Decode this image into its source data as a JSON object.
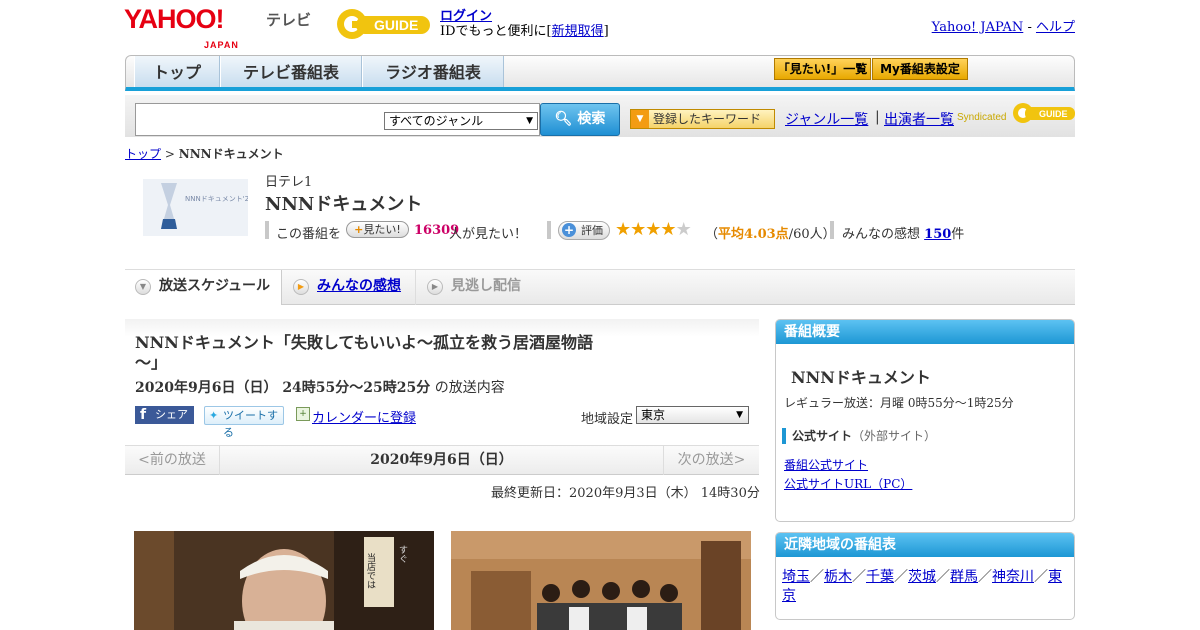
{
  "header": {
    "yahoo_logo": "YAHOO!",
    "yahoo_sub": "JAPAN",
    "tv_word": "テレビ",
    "gguide_logo": "GUIDE",
    "login_link": "ログイン",
    "login_note_prefix": "IDでもっと便利に[",
    "signup_link": "新規取得",
    "login_note_suffix": "]",
    "yahoo_japan_link": "Yahoo! JAPAN",
    "links_sep": "-",
    "help_link": "ヘルプ"
  },
  "nav": {
    "tabs": [
      "トップ",
      "テレビ番組表",
      "ラジオ番組表"
    ],
    "mitai_list": "「見たい!」一覧",
    "my_listing": "My番組表設定"
  },
  "search": {
    "input_value": "",
    "genre_selected": "すべてのジャンル",
    "search_button": "検索",
    "keyword_button": "登録したキーワード",
    "genre_list_link": "ジャンル一覧",
    "separator": "|",
    "cast_list_link": "出演者一覧",
    "syndicated": "Syndicated",
    "synd_logo": "GUIDE"
  },
  "breadcrumb": {
    "top": "トップ",
    "sep": ">",
    "current": "NNNドキュメント"
  },
  "program": {
    "thumb_text": "NNNドキュメント'20",
    "channel": "日テレ1",
    "title": "NNNドキュメント",
    "want_prefix": "この番組を",
    "want_button": "見たい!",
    "want_count": "16309",
    "want_suffix": "人が見たい！",
    "rate_button": "評価",
    "rating_value": 4.03,
    "avg_prefix": "（",
    "avg_label": "平均4.03点",
    "avg_suffix": "/60人）",
    "reviews_label": "みんなの感想",
    "reviews_count": "150",
    "reviews_unit": "件"
  },
  "tabs": {
    "schedule": "放送スケジュール",
    "reviews": "みんなの感想",
    "missed": "見逃し配信"
  },
  "episode": {
    "title": "NNNドキュメント「失敗してもいいよ～孤立を救う居酒屋物語～」",
    "date_bold": "2020年9月6日（日） 24時55分～25時25分",
    "date_suffix": "の放送内容",
    "share_facebook": "シェア",
    "share_twitter": "ツイートする",
    "calendar_link": "カレンダーに登録",
    "region_label": "地域設定",
    "region_selected": "東京",
    "prev_label": "<前の放送",
    "pager_date": "2020年9月6日（日）",
    "next_label": "次の放送>",
    "updated": "最終更新日：2020年9月3日（木） 14時30分",
    "photo1_sign_1": "当店では",
    "photo1_sign_2": "すぐ"
  },
  "overview": {
    "heading": "番組概要",
    "name": "NNNドキュメント",
    "regular": "レギュラー放送：月曜 0時55分～1時25分",
    "official_heading": "公式サイト",
    "official_note": "（外部サイト）",
    "link1": "番組公式サイト",
    "link2": "公式サイトURL（PC）"
  },
  "neighbors": {
    "heading": "近隣地域の番組表",
    "prefectures": [
      "埼玉",
      "栃木",
      "千葉",
      "茨城",
      "群馬",
      "神奈川",
      "東京"
    ],
    "separator": "／"
  },
  "colors": {
    "accent_blue": "#1d97d4",
    "want_count": "#cc0066",
    "rating_orange": "#e68a00",
    "star": "#f0a000"
  }
}
